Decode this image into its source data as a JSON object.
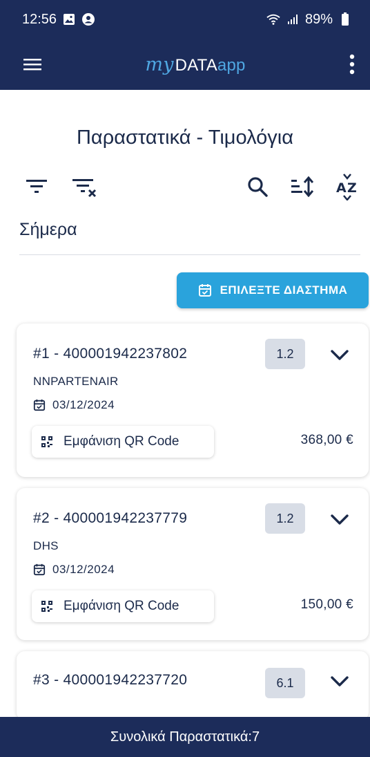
{
  "status": {
    "time": "12:56",
    "battery": "89%"
  },
  "app": {
    "brand_part1": "my",
    "brand_part2": "DATA",
    "brand_part3": "app"
  },
  "page": {
    "title": "Παραστατικά - Τιμολόγια",
    "section_label": "Σήμερα",
    "date_button": "ΕΠΙΛΕΞΤΕ ΔΙΑΣΤΗΜΑ"
  },
  "documents": [
    {
      "title": "#1 - 400001942237802",
      "badge": "1.2",
      "company": "NNPARTENAIR",
      "date": "03/12/2024",
      "qr_label": "Εμφάνιση QR Code",
      "amount": "368,00 €"
    },
    {
      "title": "#2 - 400001942237779",
      "badge": "1.2",
      "company": "DHS",
      "date": "03/12/2024",
      "qr_label": "Εμφάνιση QR Code",
      "amount": "150,00 €"
    },
    {
      "title": "#3 - 400001942237720",
      "badge": "6.1"
    }
  ],
  "footer": {
    "total": "Συνολικά Παραστατικά:7"
  },
  "colors": {
    "navy": "#1c2c5a",
    "accent": "#2aa3dc",
    "badge_bg": "#d8dde6"
  }
}
